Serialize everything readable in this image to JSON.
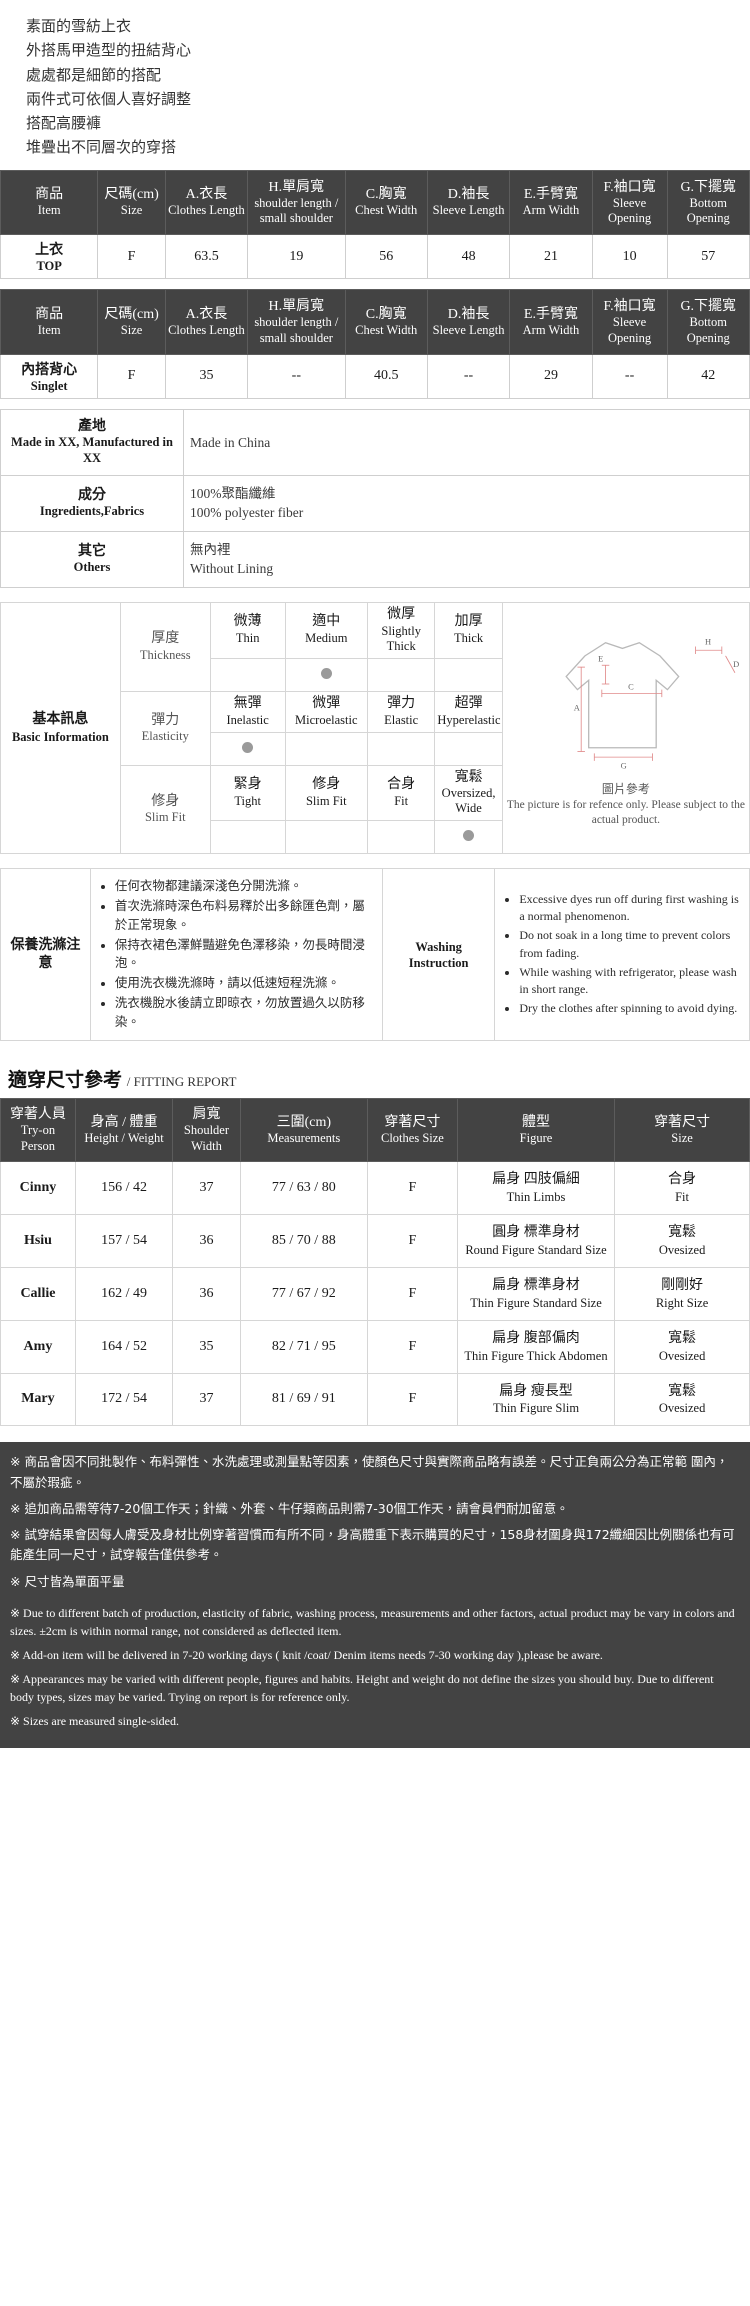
{
  "intro_lines": [
    "素面的雪紡上衣",
    "外搭馬甲造型的扭結背心",
    "處處都是細節的搭配",
    "兩件式可依個人喜好調整",
    "搭配高腰褲",
    "堆疊出不同層次的穿搭"
  ],
  "spec_table": {
    "headers": [
      {
        "zh": "商品",
        "en": "Item"
      },
      {
        "zh": "尺碼(cm)",
        "en": "Size"
      },
      {
        "zh": "A.衣長",
        "en": "Clothes Length"
      },
      {
        "zh": "H.單肩寬",
        "en": "shoulder length / small shoulder"
      },
      {
        "zh": "C.胸寬",
        "en": "Chest Width"
      },
      {
        "zh": "D.袖長",
        "en": "Sleeve Length"
      },
      {
        "zh": "E.手臂寬",
        "en": "Arm Width"
      },
      {
        "zh": "F.袖口寬",
        "en": "Sleeve Opening"
      },
      {
        "zh": "G.下擺寬",
        "en": "Bottom Opening"
      }
    ],
    "rows": [
      {
        "label_zh": "上衣",
        "label_en": "TOP",
        "values": [
          "F",
          "63.5",
          "19",
          "56",
          "48",
          "21",
          "10",
          "57"
        ]
      }
    ]
  },
  "spec_table2": {
    "headers": [
      {
        "zh": "商品",
        "en": "Item"
      },
      {
        "zh": "尺碼(cm)",
        "en": "Size"
      },
      {
        "zh": "A.衣長",
        "en": "Clothes Length"
      },
      {
        "zh": "H.單肩寬",
        "en": "shoulder length / small shoulder"
      },
      {
        "zh": "C.胸寬",
        "en": "Chest Width"
      },
      {
        "zh": "D.袖長",
        "en": "Sleeve Length"
      },
      {
        "zh": "E.手臂寬",
        "en": "Arm Width"
      },
      {
        "zh": "F.袖口寬",
        "en": "Sleeve Opening"
      },
      {
        "zh": "G.下擺寬",
        "en": "Bottom Opening"
      }
    ],
    "rows": [
      {
        "label_zh": "內搭背心",
        "label_en": "Singlet",
        "values": [
          "F",
          "35",
          "--",
          "40.5",
          "--",
          "29",
          "--",
          "42"
        ]
      }
    ]
  },
  "info_rows": [
    {
      "label_zh": "產地",
      "label_en": "Made in XX, Manufactured in XX",
      "value_lines": [
        "Made in China"
      ]
    },
    {
      "label_zh": "成分",
      "label_en": "Ingredients,Fabrics",
      "value_lines": [
        "100%聚酯纖維",
        "100% polyester fiber"
      ]
    },
    {
      "label_zh": "其它",
      "label_en": "Others",
      "value_lines": [
        "無內裡",
        "Without Lining"
      ]
    }
  ],
  "basic_info": {
    "title_zh": "基本訊息",
    "title_en": "Basic Information",
    "attributes": [
      {
        "name_zh": "厚度",
        "name_en": "Thickness",
        "options": [
          {
            "zh": "微薄",
            "en": "Thin"
          },
          {
            "zh": "適中",
            "en": "Medium"
          },
          {
            "zh": "微厚",
            "en": "Slightly Thick"
          },
          {
            "zh": "加厚",
            "en": "Thick"
          }
        ],
        "selected_index": 1
      },
      {
        "name_zh": "彈力",
        "name_en": "Elasticity",
        "options": [
          {
            "zh": "無彈",
            "en": "Inelastic"
          },
          {
            "zh": "微彈",
            "en": "Microelastic"
          },
          {
            "zh": "彈力",
            "en": "Elastic"
          },
          {
            "zh": "超彈",
            "en": "Hyperelastic"
          }
        ],
        "selected_index": 0
      },
      {
        "name_zh": "修身",
        "name_en": "Slim Fit",
        "options": [
          {
            "zh": "緊身",
            "en": "Tight"
          },
          {
            "zh": "修身",
            "en": "Slim Fit"
          },
          {
            "zh": "合身",
            "en": "Fit"
          },
          {
            "zh": "寬鬆",
            "en": "Oversized, Wide"
          }
        ],
        "selected_index": 3
      }
    ],
    "diagram": {
      "caption_zh": "圖片參考",
      "caption_en": "The picture is for refence only. Please subject to the actual product.",
      "labels": [
        "A",
        "C",
        "E",
        "G",
        "H",
        "D"
      ]
    }
  },
  "washing": {
    "label_zh": "保養洗滌注意",
    "label_mid_zh": "",
    "label_mid_en": "Washing Instruction",
    "zh_items": [
      "任何衣物都建議深淺色分開洗滌。",
      "首次洗滌時深色布料易釋於出多餘匯色劑，屬於正常現象。",
      "保持衣裙色澤鮮豔避免色澤移染，勿長時間浸泡。",
      "使用洗衣機洗滌時，請以低速短程洗滌。",
      "洗衣機脫水後請立即晾衣，勿放置過久以防移染。"
    ],
    "en_items": [
      "Excessive dyes run off during first washing is a normal phenomenon.",
      "Do not soak in a long time to prevent colors from fading.",
      "While washing with refrigerator, please wash in short range.",
      "Dry the clothes after spinning to avoid dying."
    ]
  },
  "fitting_report": {
    "title_zh": "適穿尺寸參考",
    "title_en": "/ FITTING REPORT",
    "headers": [
      {
        "zh": "穿著人員",
        "en": "Try-on Person"
      },
      {
        "zh": "身高 / 體重",
        "en": "Height / Weight"
      },
      {
        "zh": "肩寬",
        "en": "Shoulder Width"
      },
      {
        "zh": "三圍(cm)",
        "en": "Measurements"
      },
      {
        "zh": "穿著尺寸",
        "en": "Clothes Size"
      },
      {
        "zh": "體型",
        "en": "Figure"
      },
      {
        "zh": "穿著尺寸",
        "en": "Size"
      }
    ],
    "rows": [
      {
        "person": "Cinny",
        "height_weight": "156 / 42",
        "shoulder": "37",
        "measurements": "77 / 63 / 80",
        "clothes_size": "F",
        "figure_zh": "扁身 四肢偏細",
        "figure_en": "Thin Limbs",
        "size_zh": "合身",
        "size_en": "Fit"
      },
      {
        "person": "Hsiu",
        "height_weight": "157 / 54",
        "shoulder": "36",
        "measurements": "85 / 70 / 88",
        "clothes_size": "F",
        "figure_zh": "圓身 標準身材",
        "figure_en": "Round Figure Standard Size",
        "size_zh": "寬鬆",
        "size_en": "Ovesized"
      },
      {
        "person": "Callie",
        "height_weight": "162 / 49",
        "shoulder": "36",
        "measurements": "77 / 67 / 92",
        "clothes_size": "F",
        "figure_zh": "扁身 標準身材",
        "figure_en": "Thin Figure Standard Size",
        "size_zh": "剛剛好",
        "size_en": "Right Size"
      },
      {
        "person": "Amy",
        "height_weight": "164 / 52",
        "shoulder": "35",
        "measurements": "82 / 71 / 95",
        "clothes_size": "F",
        "figure_zh": "扁身 腹部偏肉",
        "figure_en": "Thin Figure Thick Abdomen",
        "size_zh": "寬鬆",
        "size_en": "Ovesized"
      },
      {
        "person": "Mary",
        "height_weight": "172 / 54",
        "shoulder": "37",
        "measurements": "81 / 69 / 91",
        "clothes_size": "F",
        "figure_zh": "扁身 瘦長型",
        "figure_en": "Thin Figure Slim",
        "size_zh": "寬鬆",
        "size_en": "Ovesized"
      }
    ]
  },
  "footer_notes": {
    "zh": [
      "※ 商品會因不同批製作、布料彈性、水洗處理或測量點等因素，使顏色尺寸與實際商品略有誤差。尺寸正負兩公分為正常範 圍內，不屬於瑕疵。",
      "※ 追加商品需等待7-20個工作天；針織、外套、牛仔類商品則需7-30個工作天，請會員們耐加留意。",
      "※ 試穿結果會因每人膚受及身材比例穿著習慣而有所不同，身高體重下表示購買的尺寸，158身材圍身與172纖細因比例關係也有可能產生同一尺寸，試穿報告僅供參考。",
      "※ 尺寸皆為單面平量"
    ],
    "en": [
      "※ Due to different batch of production, elasticity of fabric, washing process, measurements and other factors, actual product may be vary in colors and sizes. ±2cm is within normal range, not considered as deflected item.",
      "※ Add-on item will be delivered in 7-20 working days ( knit /coat/ Denim items needs 7-30 working day ),please be aware.",
      "※ Appearances may be varied with different people, figures and habits. Height and weight do not define the sizes you should buy. Due to different body types, sizes may be varied. Trying on report is for reference only.",
      "※ Sizes are measured single-sided."
    ]
  },
  "colors": {
    "header_bg": "#434343",
    "header_text": "#ffffff",
    "border": "#cfcfcf",
    "dot": "#9a9a9a"
  }
}
